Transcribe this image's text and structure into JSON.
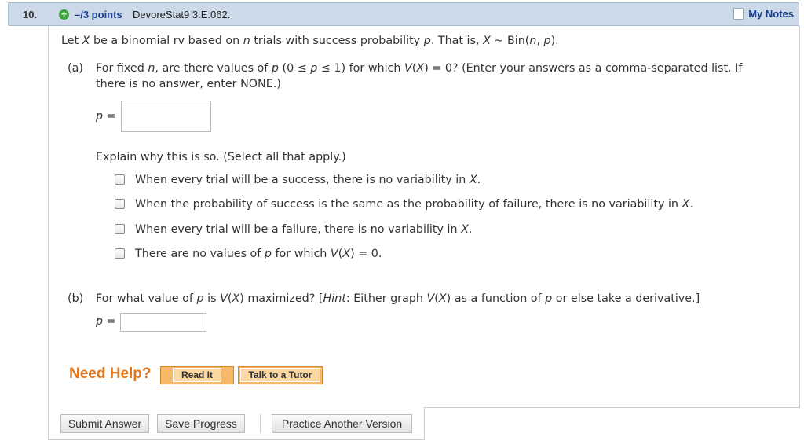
{
  "header": {
    "question_number": "10.",
    "points": "–/3 points",
    "reference": "DevoreStat9 3.E.062.",
    "my_notes": "My Notes"
  },
  "intro": {
    "t1": "Let ",
    "X": "X",
    "t2": " be a binomial rv based on ",
    "n": "n",
    "t3": " trials with success probability ",
    "p": "p",
    "t4": ". That is, ",
    "X2": "X",
    "t5": " ~ Bin(",
    "n2": "n",
    "t6": ", ",
    "p2": "p",
    "t7": ")."
  },
  "part_a": {
    "label": "(a)",
    "l1_a": "For fixed ",
    "l1_n": "n",
    "l1_b": ", are there values of ",
    "l1_p": "p",
    "l1_c": " (0 ≤ ",
    "l1_p2": "p",
    "l1_d": " ≤ 1) for which ",
    "l1_V": "V",
    "l1_e": "(",
    "l1_X": "X",
    "l1_f": ") = 0? (Enter your answers as a comma-separated list. If",
    "line2": "there is no answer, enter NONE.)",
    "input_label_p": "p",
    "input_label_eq": " =",
    "input_value": "",
    "explain": "Explain why this is so. (Select all that apply.)",
    "options": [
      {
        "pre": "When every trial will be a success, there is no variability in ",
        "var": "X",
        "post": "."
      },
      {
        "pre": "When the probability of success is the same as the probability of failure, there is no variability in ",
        "var": "X",
        "post": "."
      },
      {
        "pre": "When every trial will be a failure, there is no variability in ",
        "var": "X",
        "post": "."
      },
      {
        "pre": "There are no values of ",
        "var": "p",
        "mid": " for which ",
        "var2": "V",
        "mid2": "(",
        "var3": "X",
        "post": ") = 0."
      }
    ]
  },
  "part_b": {
    "label": "(b)",
    "a": "For what value of ",
    "p": "p",
    "b": " is ",
    "V": "V",
    "c": "(",
    "X": "X",
    "d": ") maximized? [",
    "hint": "Hint",
    "e": ": Either graph ",
    "V2": "V",
    "f": "(",
    "X2": "X",
    "g": ") as a function of ",
    "p2": "p",
    "h": " or else take a derivative.]",
    "input_label_p": "p",
    "input_label_eq": " =",
    "input_value": ""
  },
  "help": {
    "need_help": "Need Help?",
    "read_it": "Read It",
    "talk_tutor": "Talk to a Tutor"
  },
  "buttons": {
    "submit": "Submit Answer",
    "save": "Save Progress",
    "practice": "Practice Another Version"
  },
  "colors": {
    "header_bg": "#ccd9e8",
    "points_blue": "#1a3d8f",
    "need_help_orange": "#e5761a",
    "plus_green": "#3aa33a"
  }
}
